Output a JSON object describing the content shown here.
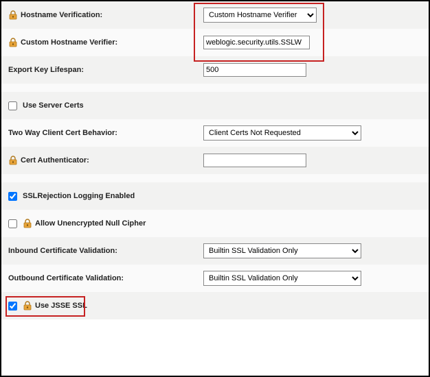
{
  "fields": {
    "hostname_verification": {
      "label": "Hostname Verification:",
      "value": "Custom Hostname Verifier"
    },
    "custom_hostname_verifier": {
      "label": "Custom Hostname Verifier:",
      "value": "weblogic.security.utils.SSLW"
    },
    "export_key_lifespan": {
      "label": "Export Key Lifespan:",
      "value": "500"
    },
    "use_server_certs": {
      "label": "Use Server Certs"
    },
    "two_way_client_cert": {
      "label": "Two Way Client Cert Behavior:",
      "value": "Client Certs Not Requested"
    },
    "cert_authenticator": {
      "label": "Cert Authenticator:",
      "value": ""
    },
    "ssl_rejection_logging": {
      "label": "SSLRejection Logging Enabled"
    },
    "allow_unencrypted_null_cipher": {
      "label": "Allow Unencrypted Null Cipher"
    },
    "inbound_cert_validation": {
      "label": "Inbound Certificate Validation:",
      "value": "Builtin SSL Validation Only"
    },
    "outbound_cert_validation": {
      "label": "Outbound Certificate Validation:",
      "value": "Builtin SSL Validation Only"
    },
    "use_jsse_ssl": {
      "label": "Use JSSE SSL"
    }
  }
}
